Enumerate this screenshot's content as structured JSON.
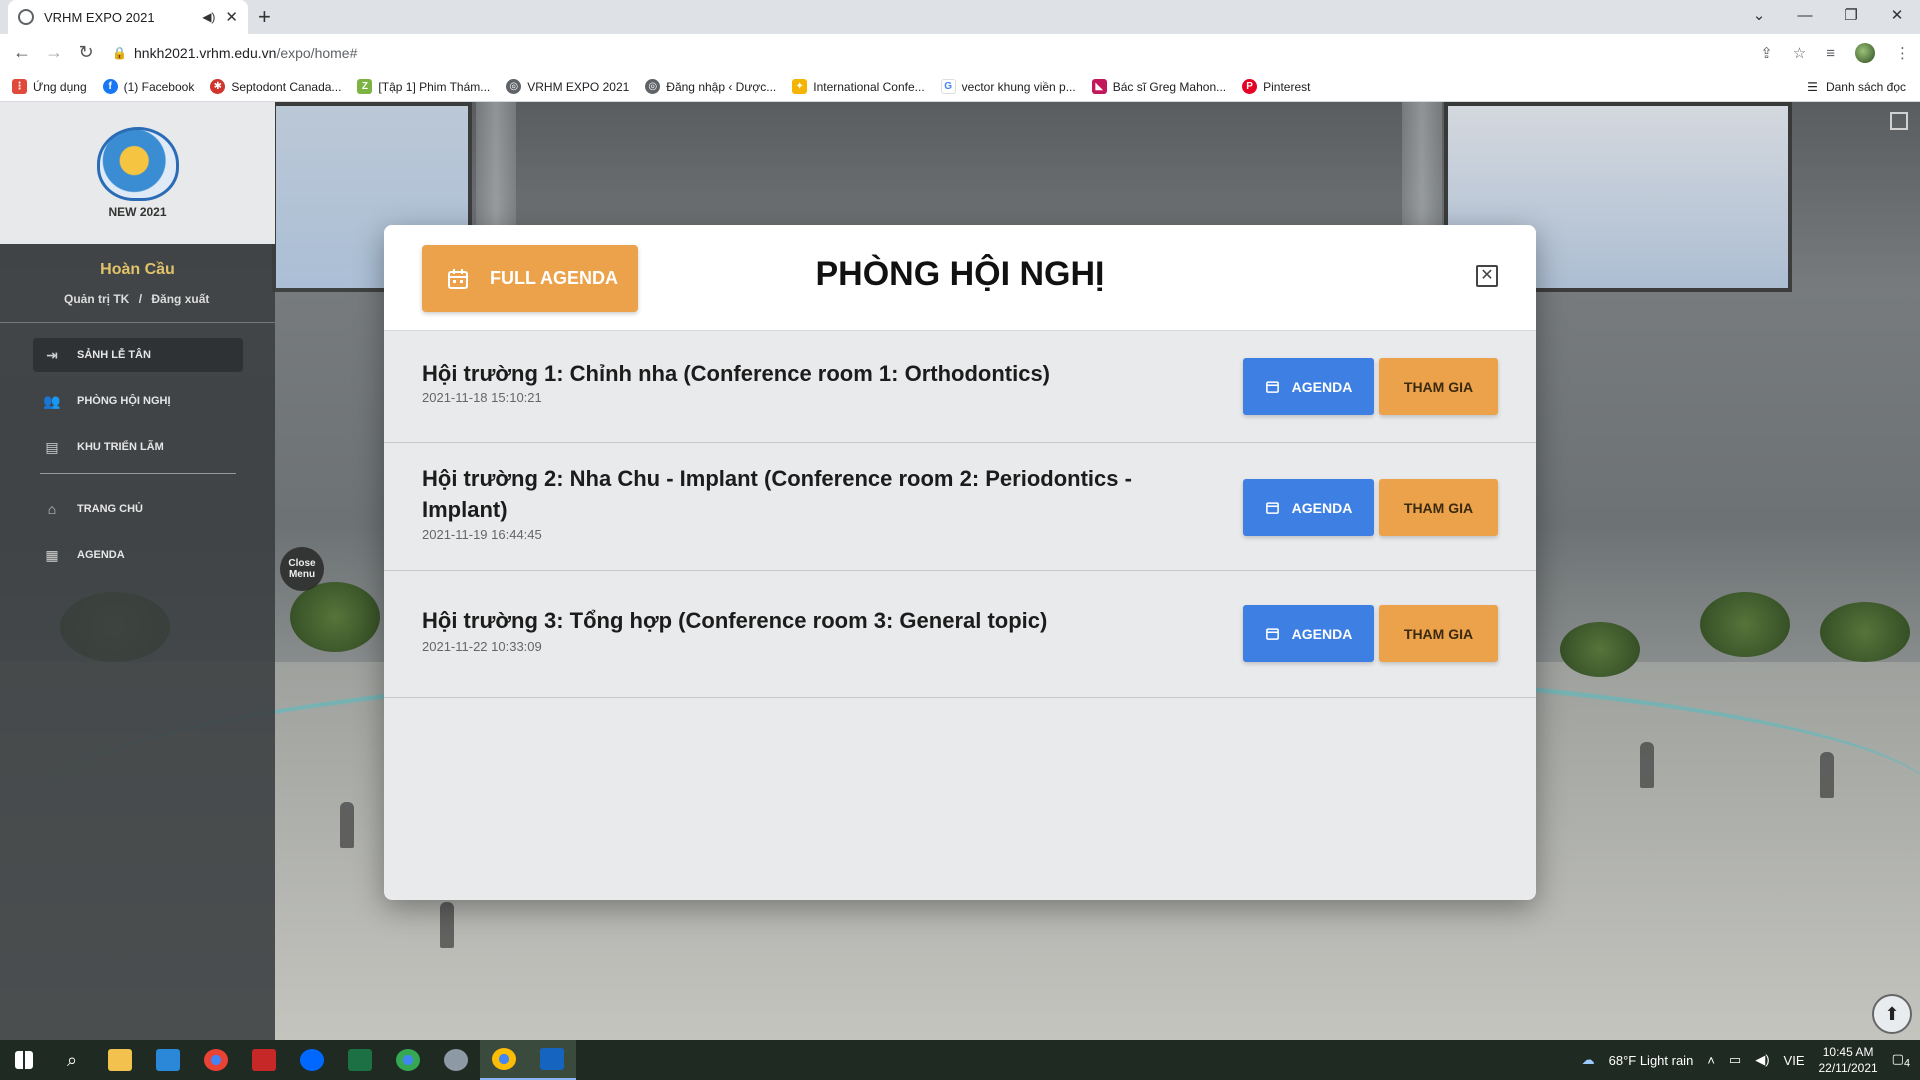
{
  "browser": {
    "tab_title": "VRHM EXPO 2021",
    "url_host": "hnkh2021.vrhm.edu.vn",
    "url_path": "/expo/home#",
    "bookmarks": [
      {
        "label": "Ứng dụng",
        "color": "#e04a3a"
      },
      {
        "label": "(1) Facebook",
        "color": "#1877f2"
      },
      {
        "label": "Septodont Canada...",
        "color": "#d0342c"
      },
      {
        "label": "[Tập 1] Phim Thám...",
        "color": "#7cb342"
      },
      {
        "label": "VRHM EXPO 2021",
        "color": "#5f6368"
      },
      {
        "label": "Đăng nhập ‹ Dược...",
        "color": "#5f6368"
      },
      {
        "label": "International Confe...",
        "color": "#f4b400"
      },
      {
        "label": "vector khung viền p...",
        "color": "#4285f4"
      },
      {
        "label": "Bác sĩ Greg Mahon...",
        "color": "#c2185b"
      },
      {
        "label": "Pinterest",
        "color": "#e60023"
      }
    ],
    "reading_list": "Danh sách đọc"
  },
  "sidebar": {
    "logo_text": "NEW 2021",
    "user_name": "Hoàn Cầu",
    "account_link": "Quản trị TK",
    "separator": "/",
    "logout_link": "Đăng xuất",
    "menu": [
      {
        "label": "SẢNH LỄ TÂN",
        "icon": "exit-door-icon"
      },
      {
        "label": "PHÒNG HỘI NGHỊ",
        "icon": "users-icon"
      },
      {
        "label": "KHU TRIỂN LÃM",
        "icon": "booth-icon"
      },
      {
        "label": "TRANG CHỦ",
        "icon": "home-icon"
      },
      {
        "label": "AGENDA",
        "icon": "calendar-icon"
      }
    ],
    "close_menu": "Close Menu"
  },
  "modal": {
    "full_agenda_label": "FULL AGENDA",
    "title": "PHÒNG HỘI NGHỊ",
    "rooms": [
      {
        "name": "Hội trường 1: Chỉnh nha (Conference room 1: Orthodontics)",
        "date": "2021-11-18 15:10:21"
      },
      {
        "name": "Hội trường 2: Nha Chu - Implant (Conference room 2: Periodontics - Implant)",
        "date": "2021-11-19 16:44:45"
      },
      {
        "name": "Hội trường 3: Tổng hợp (Conference room 3: General topic)",
        "date": "2021-11-22 10:33:09"
      }
    ],
    "agenda_label": "AGENDA",
    "join_label": "THAM GIA"
  },
  "taskbar": {
    "weather": "68°F  Light rain",
    "lang": "VIE",
    "time": "10:45 AM",
    "date": "22/11/2021",
    "notifications": "4"
  },
  "colors": {
    "orange": "#eca24a",
    "blue": "#3d7fe3",
    "gold_name": "#e2c36a"
  }
}
